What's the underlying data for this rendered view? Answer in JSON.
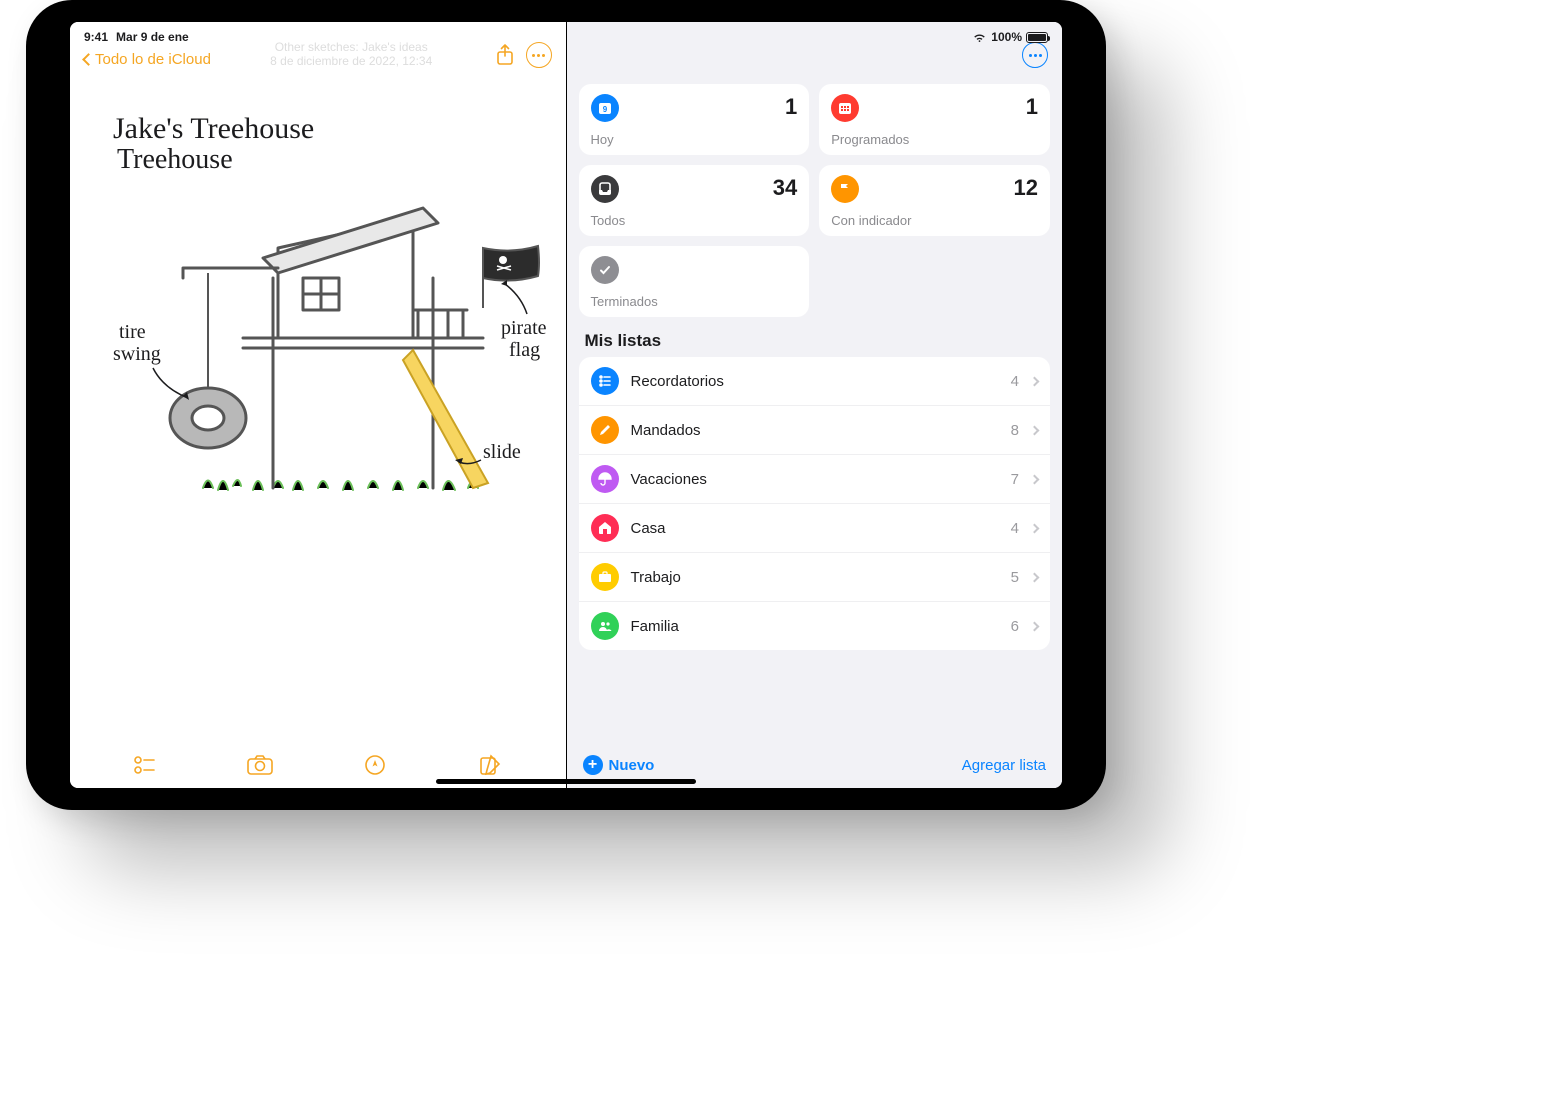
{
  "status": {
    "time": "9:41",
    "date": "Mar 9 de ene",
    "battery_pct": "100%"
  },
  "notes": {
    "back_label": "Todo lo de iCloud",
    "meta_line1": "Other sketches: Jake's ideas",
    "meta_line2": "8 de diciembre de 2022, 12:34",
    "sketch": {
      "title": "Jake's Treehouse",
      "annotations": {
        "tire_swing": "tire swing",
        "pirate_flag": "pirate flag",
        "slide": "slide"
      }
    }
  },
  "reminders": {
    "smart": [
      {
        "id": "today",
        "label": "Hoy",
        "count": "1",
        "color": "#0a84ff",
        "icon": "calendar"
      },
      {
        "id": "scheduled",
        "label": "Programados",
        "count": "1",
        "color": "#ff3b30",
        "icon": "calendar-grid"
      },
      {
        "id": "all",
        "label": "Todos",
        "count": "34",
        "color": "#3a3a3c",
        "icon": "tray"
      },
      {
        "id": "flagged",
        "label": "Con indicador",
        "count": "12",
        "color": "#ff9500",
        "icon": "flag"
      },
      {
        "id": "done",
        "label": "Terminados",
        "count": "",
        "color": "#8e8e93",
        "icon": "check"
      }
    ],
    "section_title": "Mis listas",
    "lists": [
      {
        "name": "Recordatorios",
        "count": "4",
        "color": "#0a84ff",
        "icon": "list"
      },
      {
        "name": "Mandados",
        "count": "8",
        "color": "#ff9500",
        "icon": "pencil"
      },
      {
        "name": "Vacaciones",
        "count": "7",
        "color": "#bf5af2",
        "icon": "umbrella"
      },
      {
        "name": "Casa",
        "count": "4",
        "color": "#ff2d55",
        "icon": "home"
      },
      {
        "name": "Trabajo",
        "count": "5",
        "color": "#ffcc00",
        "icon": "briefcase"
      },
      {
        "name": "Familia",
        "count": "6",
        "color": "#30d158",
        "icon": "people"
      }
    ],
    "new_label": "Nuevo",
    "add_list_label": "Agregar lista"
  }
}
